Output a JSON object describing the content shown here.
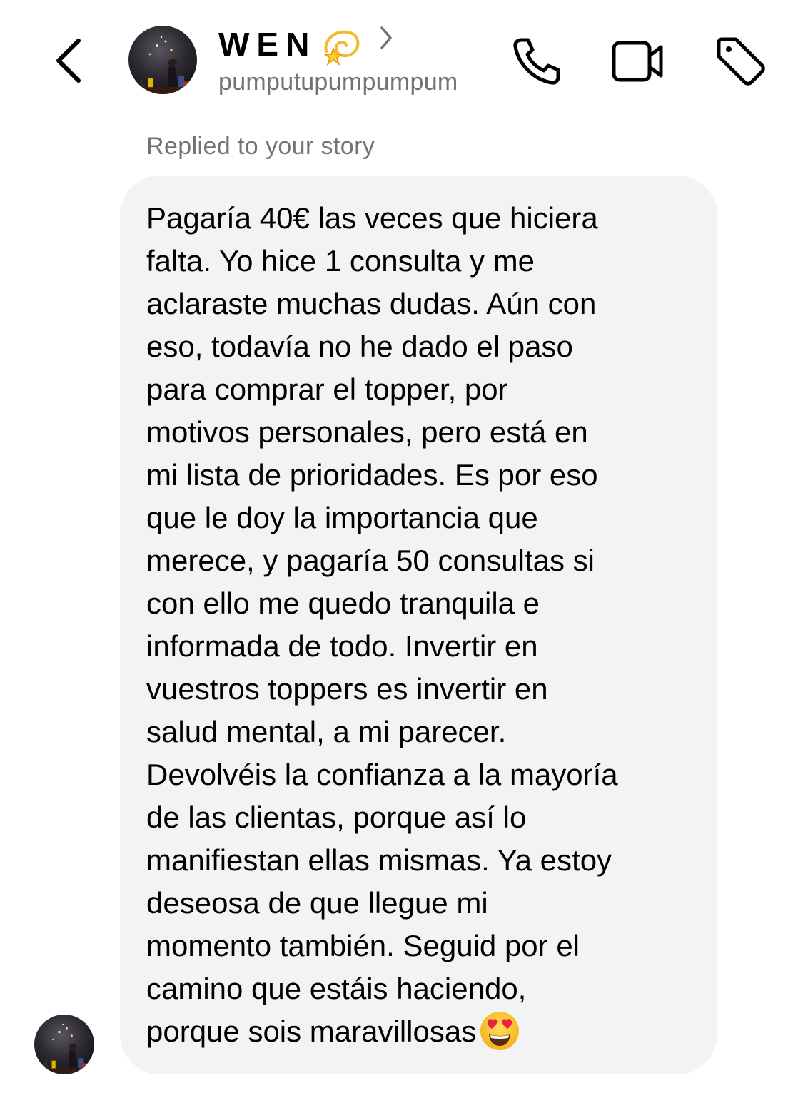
{
  "header": {
    "back_icon": "chevron-left-icon",
    "display_name": "WEN",
    "name_emoji": "dizzy-emoji",
    "username": "pumputupumpumpum",
    "actions": [
      "phone-icon",
      "video-camera-icon",
      "tag-icon"
    ]
  },
  "thread": {
    "reply_label": "Replied to your story",
    "message_lines": [
      "Pagaría 40€ las veces que hiciera",
      "falta. Yo hice 1 consulta y me",
      "aclaraste muchas dudas. Aún con",
      "eso, todavía no he dado el paso",
      "para comprar el topper, por",
      "motivos personales, pero está en",
      "mi lista de prioridades. Es por eso",
      "que le doy la importancia que",
      "merece, y pagaría 50 consultas si",
      "con ello me quedo tranquila e",
      "informada de todo. Invertir en",
      "vuestros toppers es invertir en",
      "salud mental, a mi parecer.",
      "Devolvéis la confianza a la mayoría",
      "de las clientas, porque así lo",
      "manifiestan ellas mismas. Ya estoy",
      "deseosa de que llegue mi",
      "momento también. Seguid por el",
      "camino que estáis haciendo,",
      "porque sois maravillosas"
    ],
    "trailing_emoji": "heart-eyes-emoji"
  },
  "colors": {
    "bubble_bg": "#f2f3f5",
    "secondary_text": "#737373",
    "divider": "#e6e6e6"
  }
}
